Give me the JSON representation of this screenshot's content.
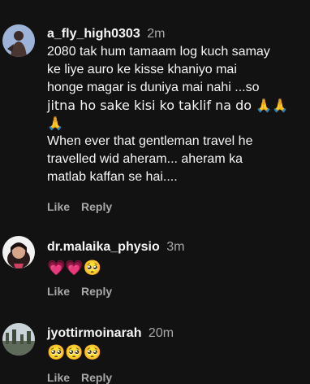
{
  "comments": [
    {
      "username": "a_fly_high0303",
      "time": "2m",
      "lines": [
        "2080 tak hum tamaam log kuch samay",
        "ke liye auro ke kisse khaniyo mai",
        "honge magar is duniya mai nahi ...so",
        "jitna ho sake kisi ko taklif na do 🙏🙏",
        "🙏",
        "When ever that gentleman travel he",
        "travelled wid aheram... aheram ka",
        "matlab kaffan se hai...."
      ],
      "like_label": "Like",
      "reply_label": "Reply"
    },
    {
      "username": "dr.malaika_physio",
      "time": "3m",
      "lines": [
        "💗💗🥺"
      ],
      "like_label": "Like",
      "reply_label": "Reply"
    },
    {
      "username": "jyottirmoinarah",
      "time": "20m",
      "lines": [
        "🥺🥺🥺"
      ],
      "like_label": "Like",
      "reply_label": "Reply"
    }
  ]
}
